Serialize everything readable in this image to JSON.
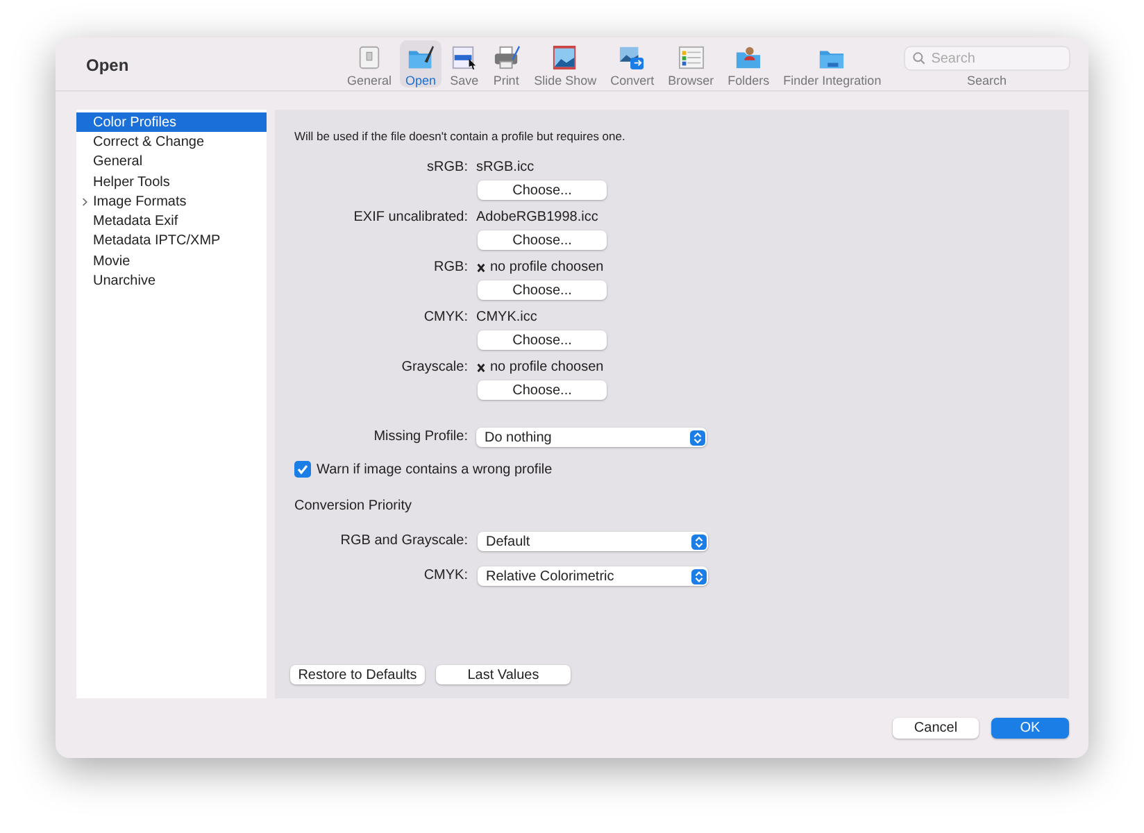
{
  "window": {
    "title": "Open"
  },
  "toolbar": [
    {
      "label": "General",
      "selected": false
    },
    {
      "label": "Open",
      "selected": true
    },
    {
      "label": "Save",
      "selected": false
    },
    {
      "label": "Print",
      "selected": false
    },
    {
      "label": "Slide Show",
      "selected": false
    },
    {
      "label": "Convert",
      "selected": false
    },
    {
      "label": "Browser",
      "selected": false
    },
    {
      "label": "Folders",
      "selected": false
    },
    {
      "label": "Finder Integration",
      "selected": false
    }
  ],
  "search": {
    "placeholder": "Search",
    "label": "Search"
  },
  "sidebar": {
    "items": [
      {
        "label": "Color Profiles",
        "selected": true,
        "expandable": false
      },
      {
        "label": "Correct & Change",
        "selected": false,
        "expandable": false
      },
      {
        "label": "General",
        "selected": false,
        "expandable": false
      },
      {
        "label": "Helper Tools",
        "selected": false,
        "expandable": false
      },
      {
        "label": "Image Formats",
        "selected": false,
        "expandable": true
      },
      {
        "label": "Metadata Exif",
        "selected": false,
        "expandable": false
      },
      {
        "label": "Metadata IPTC/XMP",
        "selected": false,
        "expandable": false
      },
      {
        "label": "Movie",
        "selected": false,
        "expandable": false
      },
      {
        "label": "Unarchive",
        "selected": false,
        "expandable": false
      }
    ]
  },
  "description": "Will be used if the file doesn't contain a profile but requires one.",
  "profiles": [
    {
      "label": "sRGB:",
      "value": "sRGB.icc",
      "missing": false,
      "button": "Choose..."
    },
    {
      "label": "EXIF uncalibrated:",
      "value": "AdobeRGB1998.icc",
      "missing": false,
      "button": "Choose..."
    },
    {
      "label": "RGB:",
      "value": "no profile choosen",
      "missing": true,
      "button": "Choose..."
    },
    {
      "label": "CMYK:",
      "value": "CMYK.icc",
      "missing": false,
      "button": "Choose..."
    },
    {
      "label": "Grayscale:",
      "value": "no profile choosen",
      "missing": true,
      "button": "Choose..."
    }
  ],
  "missing_profile": {
    "label": "Missing Profile:",
    "value": "Do nothing"
  },
  "warn_checkbox": {
    "label": "Warn if image contains a wrong profile",
    "checked": true
  },
  "conversion_heading": "Conversion Priority",
  "conversion": [
    {
      "label": "RGB and Grayscale:",
      "value": "Default"
    },
    {
      "label": "CMYK:",
      "value": "Relative Colorimetric"
    }
  ],
  "panel_buttons": [
    "Restore to Defaults",
    "Last Values"
  ],
  "dialog_buttons": [
    {
      "label": "Cancel",
      "default": false
    },
    {
      "label": "OK",
      "default": true
    }
  ]
}
